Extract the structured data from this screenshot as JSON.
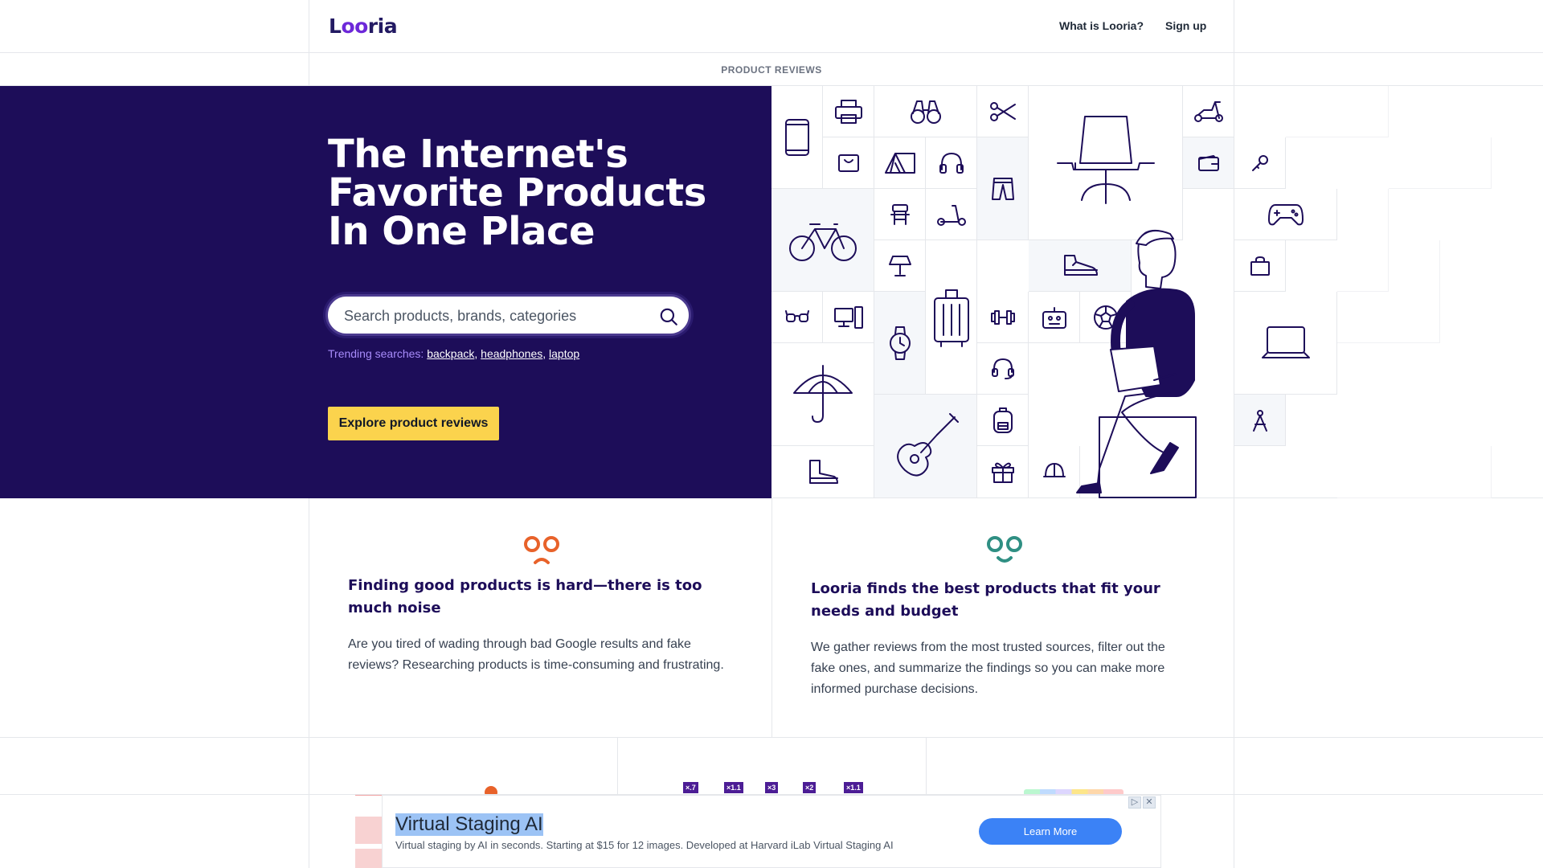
{
  "header": {
    "logo": "Looria",
    "nav": [
      "What is Looria?",
      "Sign up"
    ]
  },
  "subbar": {
    "label": "PRODUCT REVIEWS"
  },
  "hero": {
    "title": "The Internet's Favorite Products In One Place",
    "search_placeholder": "Search products, brands, categories",
    "trending_label": "Trending searches:",
    "trending": [
      "backpack",
      "headphones",
      "laptop"
    ],
    "cta": "Explore product reviews"
  },
  "features": [
    {
      "icon": "sad-face-icon",
      "icon_color": "#e8622a",
      "title": "Finding good products is hard—there is too much noise",
      "body": "Are you tired of wading through bad Google results and fake reviews? Researching products is time-consuming and frustrating."
    },
    {
      "icon": "happy-face-icon",
      "icon_color": "#2f8f83",
      "title": "Looria finds the best products that fit your needs and budget",
      "body": "We gather reviews from the most trusted sources, filter out the fake ones, and summarize the findings so you can make more informed purchase decisions."
    }
  ],
  "bottom_row": {
    "badges": [
      "×.7",
      "×1.1",
      "×3",
      "×2",
      "×1.1"
    ]
  },
  "ad": {
    "title": "Virtual Staging AI",
    "description": "Virtual staging by AI in seconds. Starting at $15 for 12 images. Developed at Harvard iLab Virtual Staging AI",
    "button": "Learn More"
  },
  "colors": {
    "hero_bg": "#1d0d59",
    "cta_bg": "#fbd34d",
    "accent": "#6d28d9"
  }
}
